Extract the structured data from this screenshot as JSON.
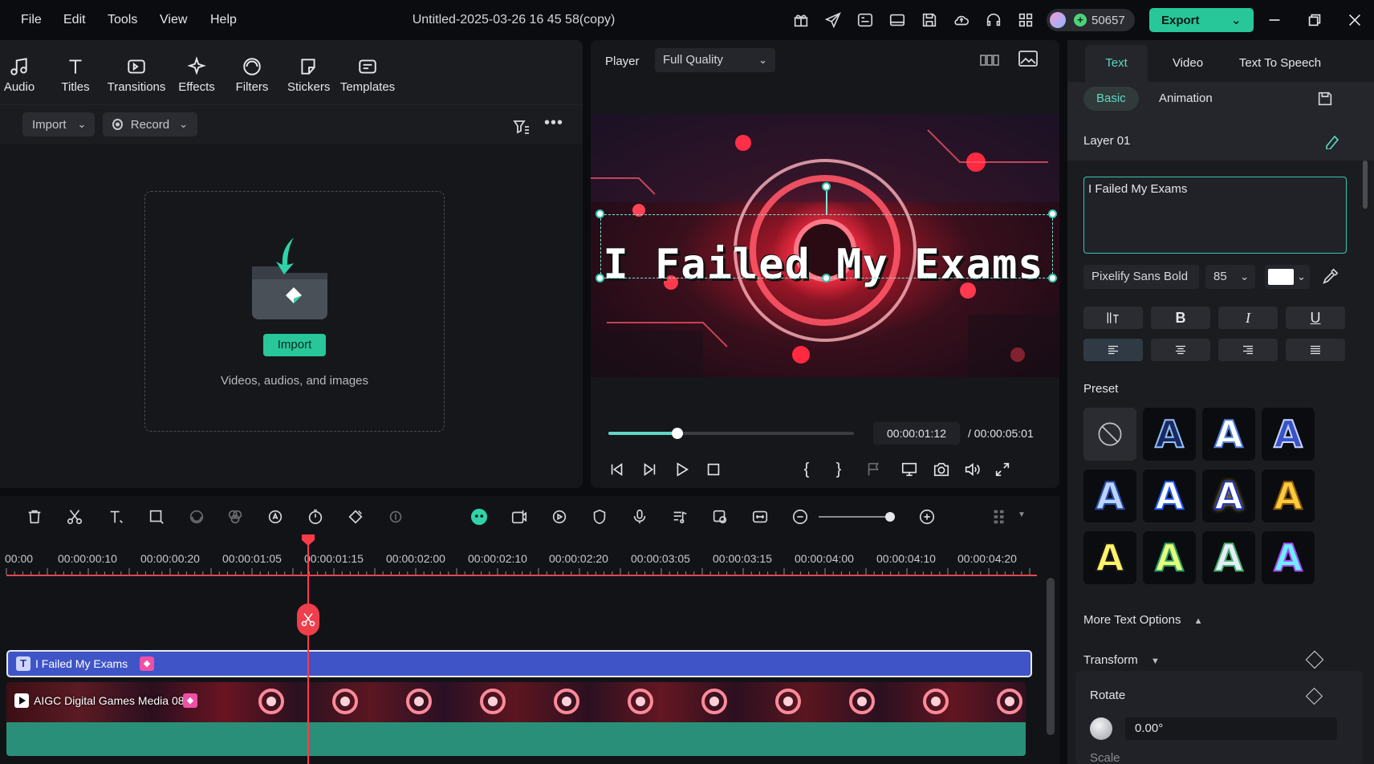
{
  "menu": {
    "items": [
      "File",
      "Edit",
      "Tools",
      "View",
      "Help"
    ]
  },
  "title": "Untitled-2025-03-26 16 45 58(copy)",
  "credits": "50657",
  "export_label": "Export",
  "media": {
    "tabs": [
      "Audio",
      "Titles",
      "Transitions",
      "Effects",
      "Filters",
      "Stickers",
      "Templates"
    ],
    "import_select": "Import",
    "record_select": "Record",
    "import_button": "Import",
    "drop_subtitle": "Videos, audios, and images"
  },
  "player": {
    "label": "Player",
    "quality": "Full Quality",
    "overlay_text": "I Failed My Exams",
    "current_time": "00:00:01:12",
    "total_time": "/  00:00:05:01",
    "progress": 0.28
  },
  "props": {
    "tabs": [
      "Text",
      "Video",
      "Text To Speech"
    ],
    "subtabs": [
      "Basic",
      "Animation"
    ],
    "layer": "Layer 01",
    "text_value": "I Failed My Exams",
    "font": "Pixelify Sans Bold",
    "font_size": "85",
    "text_color": "#ffffff",
    "format_buttons": [
      "B",
      "I",
      "U"
    ],
    "preset_label": "Preset",
    "more_options": "More Text Options",
    "transform_label": "Transform",
    "rotate_label": "Rotate",
    "rotate_value": "0.00°",
    "scale_label": "Scale"
  },
  "timeline": {
    "ticks": [
      "00:00",
      "00:00:00:10",
      "00:00:00:20",
      "00:00:01:05",
      "00:00:01:15",
      "00:00:02:00",
      "00:00:02:10",
      "00:00:02:20",
      "00:00:03:05",
      "00:00:03:15",
      "00:00:04:00",
      "00:00:04:10",
      "00:00:04:20"
    ],
    "text_clip": "I Failed My Exams",
    "video_clip": "AIGC Digital Games Media 08",
    "accent": "#27c79a",
    "playhead_color": "#ff3b4a"
  }
}
